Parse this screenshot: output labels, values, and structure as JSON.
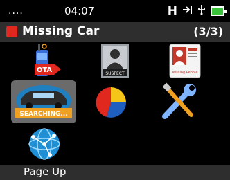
{
  "status": {
    "signal": "....",
    "time": "04:07",
    "network": "H",
    "icons": [
      "transfer-icon",
      "usb-icon",
      "battery-icon"
    ]
  },
  "title": {
    "label": "Missing Car",
    "page": "(3/3)",
    "accent": "#e0281f"
  },
  "apps": [
    {
      "name": "ota",
      "label": "OTA"
    },
    {
      "name": "suspect",
      "label": "SUSPECT"
    },
    {
      "name": "missing-people",
      "label": "Missing People"
    },
    {
      "name": "missing-car",
      "label": "SEARCHING...",
      "selected": true
    },
    {
      "name": "statistics",
      "label": ""
    },
    {
      "name": "settings",
      "label": ""
    },
    {
      "name": "network",
      "label": ""
    }
  ],
  "softkey": {
    "label": "Page Up"
  }
}
